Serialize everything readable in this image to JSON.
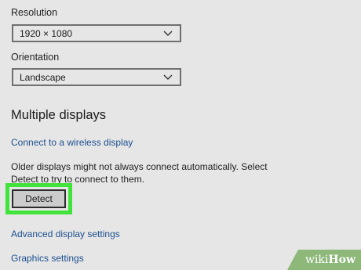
{
  "resolution": {
    "label": "Resolution",
    "value": "1920 × 1080"
  },
  "orientation": {
    "label": "Orientation",
    "value": "Landscape"
  },
  "multiple_displays": {
    "heading": "Multiple displays",
    "wireless_link": "Connect to a wireless display",
    "description": "Older displays might not always connect automatically. Select Detect to try to connect to them.",
    "detect_button": "Detect"
  },
  "links": {
    "advanced": "Advanced display settings",
    "graphics": "Graphics settings"
  },
  "watermark": {
    "prefix": "wiki",
    "suffix": "How"
  },
  "colors": {
    "background": "#e6e6e6",
    "link": "#1c4f8f",
    "highlight": "#3fe33a",
    "watermark_bg": "#8db87a"
  },
  "icons": [
    "chevron-down-icon"
  ]
}
